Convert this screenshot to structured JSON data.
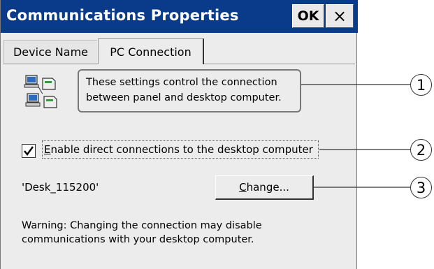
{
  "window": {
    "title": "Communications Properties",
    "ok_label": "OK",
    "close_label": "×"
  },
  "tabs": [
    {
      "label": "Device Name",
      "active": false
    },
    {
      "label": "PC Connection",
      "active": true
    }
  ],
  "info": {
    "icon": "pc-connection-icon",
    "line1": "These settings control the connection",
    "line2": "between panel and desktop computer."
  },
  "checkbox": {
    "checked": true,
    "mnemonic": "E",
    "label_rest": "nable direct connections to the desktop computer"
  },
  "connection": {
    "name": "'Desk_115200'",
    "change_mnemonic": "C",
    "change_rest": "hange..."
  },
  "warning": {
    "line1": "Warning: Changing the connection may disable",
    "line2": "communications with your desktop computer."
  },
  "callouts": [
    "1",
    "2",
    "3"
  ],
  "colors": {
    "titlebar": "#0a3a8a",
    "dialog_bg": "#ececec"
  }
}
